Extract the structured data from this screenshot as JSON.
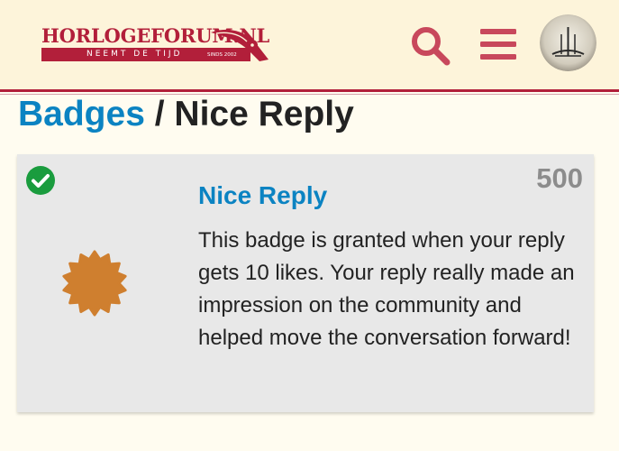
{
  "header": {
    "logo": {
      "title": "HORLOGEFORUM.NL",
      "tagline": "NEEMT DE TIJD",
      "since": "SINDS 2002"
    },
    "search_icon": "search-icon",
    "menu_icon": "hamburger-menu-icon",
    "avatar_icon": "user-avatar",
    "colors": {
      "brand": "#b21f3a",
      "header_bg": "#fdf4da"
    }
  },
  "breadcrumb": {
    "parent": "Badges",
    "separator": " / ",
    "current": "Nice Reply"
  },
  "badge": {
    "title": "Nice Reply",
    "grant_count": "500",
    "description": "This badge is granted when your reply gets 10 likes. Your reply really made an impression on the community and helped move the conversation forward!",
    "granted_icon": "check-circle-icon",
    "badge_icon": "badge-star-icon",
    "colors": {
      "badge": "#cf7f2f",
      "check": "#1a9c3e",
      "link": "#0b83c2"
    }
  }
}
